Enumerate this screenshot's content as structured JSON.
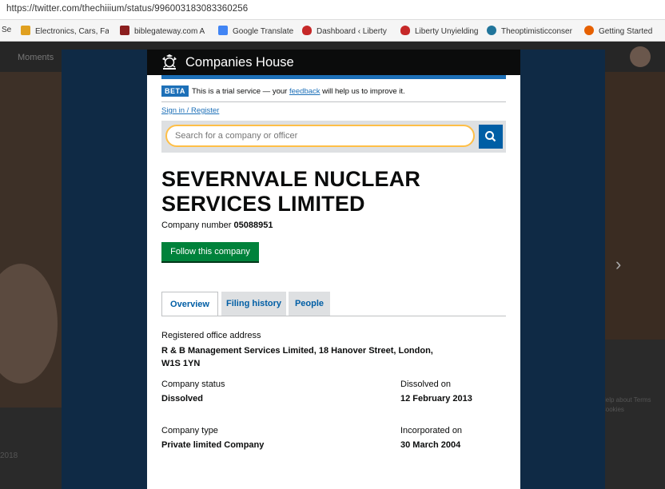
{
  "browser": {
    "url": "https://twitter.com/thechiiium/status/996003183083360256",
    "bookmarks": [
      {
        "label": "Se",
        "icon": "doc-icon",
        "color": "#888888"
      },
      {
        "label": "Electronics, Cars, Fas",
        "icon": "shopping-icon",
        "color": "#e0a020"
      },
      {
        "label": "biblegateway.com A",
        "icon": "bible-icon",
        "color": "#8b1e1e"
      },
      {
        "label": "Google Translate",
        "icon": "translate-icon",
        "color": "#4285f4"
      },
      {
        "label": "Dashboard ‹ Liberty",
        "icon": "flame-icon",
        "color": "#c62828"
      },
      {
        "label": "Liberty Unyielding",
        "icon": "flame-icon",
        "color": "#c62828"
      },
      {
        "label": "Theoptimisticconser",
        "icon": "wordpress-icon",
        "color": "#21759b"
      },
      {
        "label": "Getting Started",
        "icon": "firefox-icon",
        "color": "#e66000"
      }
    ]
  },
  "background_page": {
    "nav_label": "Moments",
    "footer_text": "Help about Terms Cookies",
    "year": "2018"
  },
  "site": {
    "title": "Companies House",
    "beta_tag": "BETA",
    "beta_text_before": "This is a trial service — your ",
    "beta_link": "feedback",
    "beta_text_after": " will help us to improve it.",
    "signin": "Sign in / Register",
    "search_placeholder": "Search for a company or officer"
  },
  "company": {
    "name": "SEVERNVALE NUCLEAR SERVICES LIMITED",
    "number_label": "Company number",
    "number": "05088951",
    "follow_label": "Follow this company"
  },
  "tabs": [
    {
      "label": "Overview"
    },
    {
      "label": "Filing history"
    },
    {
      "label": "People"
    }
  ],
  "overview": {
    "address_label": "Registered office address",
    "address_line1": "R & B Management Services Limited, 18 Hanover Street, London,",
    "address_line2": "W1S 1YN",
    "status_label": "Company status",
    "status_value": "Dissolved",
    "dissolved_label": "Dissolved on",
    "dissolved_value": "12 February 2013",
    "type_label": "Company type",
    "type_value": "Private limited Company",
    "incorporated_label": "Incorporated on",
    "incorporated_value": "30 March 2004"
  },
  "colors": {
    "modal_bg": "#0f2a45",
    "header_bg": "#0b0c0c",
    "link_blue": "#1d70b8",
    "button_green": "#00823b",
    "search_focus": "#ffbf47"
  }
}
